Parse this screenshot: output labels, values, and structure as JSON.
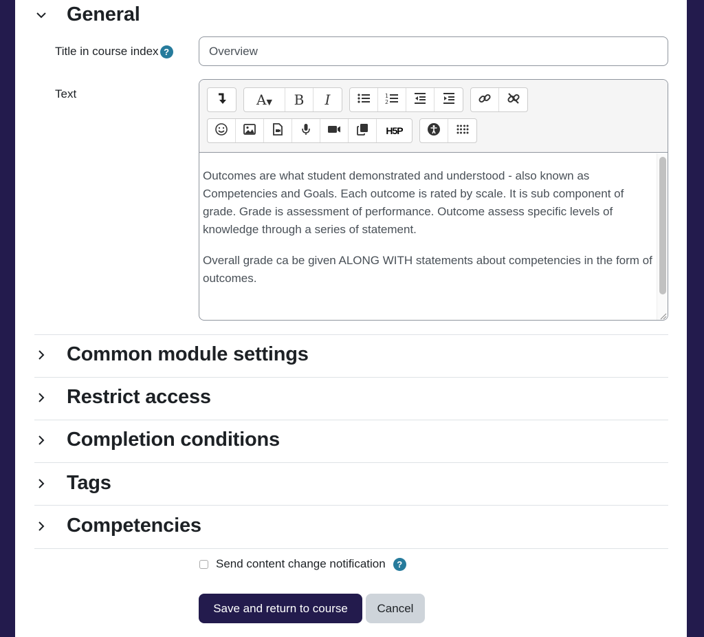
{
  "general": {
    "title": "General",
    "expanded": true,
    "title_field": {
      "label": "Title in course index",
      "help": "?",
      "value": "Overview"
    },
    "text_field": {
      "label": "Text",
      "toolbar_row1": [
        {
          "icon": "show-more-icon",
          "label": "Show more buttons"
        },
        {
          "icon": "font-style-icon",
          "label": "Paragraph styles"
        },
        {
          "icon": "bold-icon",
          "label": "Bold"
        },
        {
          "icon": "italic-icon",
          "label": "Italic"
        },
        {
          "icon": "unordered-list-icon",
          "label": "Unordered list"
        },
        {
          "icon": "ordered-list-icon",
          "label": "Ordered list"
        },
        {
          "icon": "outdent-icon",
          "label": "Outdent"
        },
        {
          "icon": "indent-icon",
          "label": "Indent"
        },
        {
          "icon": "link-icon",
          "label": "Link"
        },
        {
          "icon": "unlink-icon",
          "label": "Unlink"
        }
      ],
      "toolbar_row2": [
        {
          "icon": "emoji-icon",
          "label": "Emoji"
        },
        {
          "icon": "image-icon",
          "label": "Image"
        },
        {
          "icon": "media-icon",
          "label": "Media"
        },
        {
          "icon": "microphone-icon",
          "label": "Record audio"
        },
        {
          "icon": "video-icon",
          "label": "Record video"
        },
        {
          "icon": "copy-icon",
          "label": "Manage files"
        },
        {
          "icon": "h5p-icon",
          "label": "H5P",
          "text": "H5P"
        },
        {
          "icon": "accessibility-icon",
          "label": "Accessibility checker"
        },
        {
          "icon": "screenreader-icon",
          "label": "Screenreader helper"
        }
      ],
      "paragraphs": [
        "Outcomes are what student demonstrated and understood - also known as Competencies and Goals. Each outcome is rated by scale. It is sub component of grade. Grade is assessment of performance. Outcome assess specific levels of knowledge through a series of statement.",
        "Overall grade ca be given ALONG WITH statements about competencies in the form of outcomes."
      ]
    }
  },
  "sections": [
    {
      "title": "Common module settings"
    },
    {
      "title": "Restrict access"
    },
    {
      "title": "Completion conditions"
    },
    {
      "title": "Tags"
    },
    {
      "title": "Competencies"
    }
  ],
  "notification": {
    "label": "Send content change notification",
    "checked": false,
    "help": "?"
  },
  "buttons": {
    "save": "Save and return to course",
    "cancel": "Cancel"
  },
  "colors": {
    "brand": "#231b4d",
    "help": "#267b9c",
    "secondary": "#ced4da"
  }
}
